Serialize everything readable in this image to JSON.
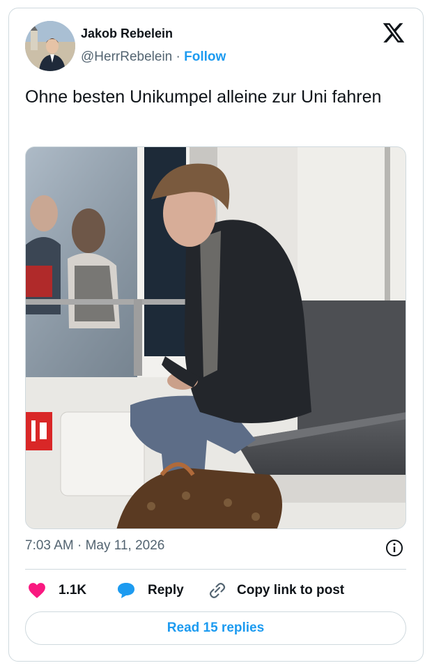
{
  "author": {
    "name": "Jakob Rebelein",
    "handle": "@HerrRebelein",
    "separator": "·",
    "follow_label": "Follow"
  },
  "tweet": {
    "text": "Ohne besten Unikumpel alleine zur Uni fahren"
  },
  "meta": {
    "time": "7:03 AM",
    "separator": "·",
    "date": "May 11, 2026"
  },
  "actions": {
    "likes_count": "1.1K",
    "reply_label": "Reply",
    "copy_link_label": "Copy link to post"
  },
  "read_replies_label": "Read 15 replies",
  "icons": {
    "brand": "x-logo-icon",
    "info": "info-icon",
    "like": "heart-icon",
    "reply": "speech-bubble-icon",
    "copy": "link-icon"
  },
  "colors": {
    "accent": "#1d9bf0",
    "like": "#f91880",
    "text": "#0f1419",
    "muted": "#536471",
    "border": "#cfd9de"
  }
}
